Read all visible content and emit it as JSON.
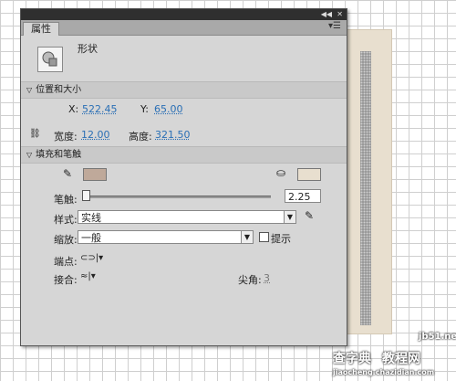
{
  "panel": {
    "tab_label": "属性",
    "collapse_icon": "double-chevron-left-icon",
    "close_icon": "close-icon",
    "menu_icon": "panel-menu-icon"
  },
  "object": {
    "type_label": "形状",
    "icon": "shape-icon"
  },
  "position_size": {
    "header": "位置和大小",
    "x_label": "X:",
    "x_value": "522.45",
    "y_label": "Y:",
    "y_value": "65.00",
    "width_label": "宽度:",
    "width_value": "12.00",
    "height_label": "高度:",
    "height_value": "321.50",
    "lock_icon": "link-chain-icon"
  },
  "fill_stroke": {
    "header": "填充和笔触",
    "stroke_color": "#bfa99a",
    "fill_color": "#e8dfcf",
    "stroke_width_label": "笔触:",
    "stroke_width_value": "2.25",
    "style_label": "样式:",
    "style_value": "实线",
    "scale_label": "缩放:",
    "scale_value": "一般",
    "hint_label": "提示",
    "cap_label": "端点:",
    "join_label": "接合:",
    "miter_label": "尖角:",
    "miter_value": "3"
  },
  "watermark": {
    "line1": "查字典",
    "line2": "教程网",
    "site": "jb51.net",
    "sub": "jiaocheng.chazidian.com"
  }
}
